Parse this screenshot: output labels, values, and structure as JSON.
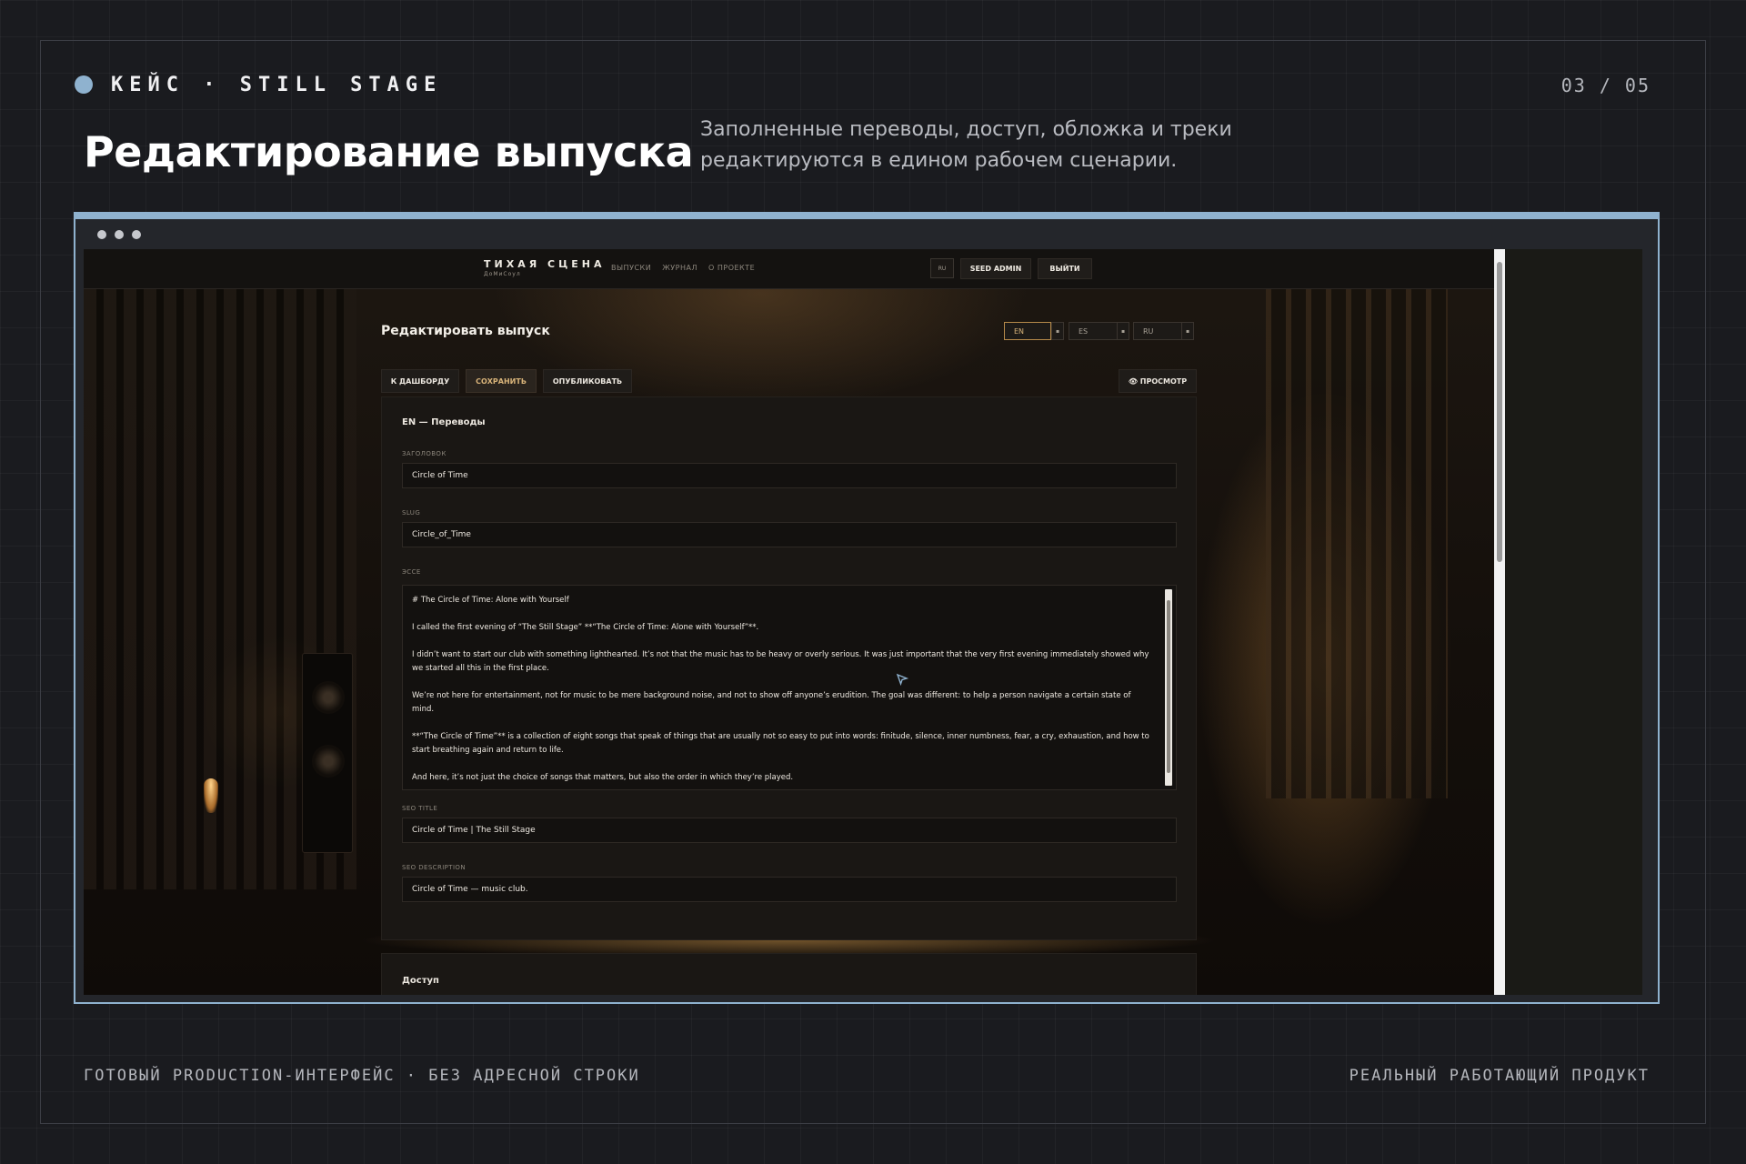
{
  "slide": {
    "kicker": "КЕЙС · STILL STAGE",
    "pager": "03 / 05",
    "title": "Редактирование выпуска",
    "subtitle": "Заполненные переводы, доступ, обложка и треки редактируются в едином рабочем сценарии.",
    "footer_left": "ГОТОВЫЙ PRODUCTION-ИНТЕРФЕЙС · БЕЗ АДРЕСНОЙ СТРОКИ",
    "footer_right": "РЕАЛЬНЫЙ РАБОТАЮЩИЙ ПРОДУКТ",
    "accent": "#8fb2cf"
  },
  "app": {
    "brand": {
      "name": "ТИХАЯ СЦЕНА",
      "sub": "ДоМиСоул"
    },
    "nav": [
      "ВЫПУСКИ",
      "ЖУРНАЛ",
      "О ПРОЕКТЕ"
    ],
    "lang_badge": "RU",
    "user_button": "SEED ADMIN",
    "logout_button": "ВЫЙТИ",
    "heading": "Редактировать выпуск",
    "languages": [
      "EN",
      "ES",
      "RU"
    ],
    "active_language": "EN",
    "actions": {
      "back": "К ДАШБОРДУ",
      "save": "СОХРАНИТЬ",
      "publish": "ОПУБЛИКОВАТЬ",
      "preview": "👁 ПРОСМОТР"
    },
    "translations": {
      "title": "EN — Переводы",
      "fields": {
        "title_label": "ЗАГОЛОВОК",
        "title_value": "Circle of Time",
        "slug_label": "SLUG",
        "slug_value": "Circle_of_Time",
        "essay_label": "ЭССЕ",
        "essay_paragraphs": [
          "# The Circle of Time: Alone with Yourself",
          "I called the first evening of “The Still Stage” **“The Circle of Time: Alone with Yourself”**.",
          "I didn’t want to start our club with something lighthearted. It’s not that the music has to be heavy or overly serious. It was just important that the very first evening immediately showed why we started all this in the first place.",
          "We’re not here for entertainment, not for music to be mere background noise, and not to show off anyone’s erudition. The goal was different: to help a person navigate a certain state of mind.",
          "**“The Circle of Time”** is a collection of eight songs that speak of things that are usually not so easy to put into words: finitude, silence, inner numbness, fear, a cry, exhaustion, and how to start breathing again and return to life.",
          "And here, it’s not just the choice of songs that matters, but also the order in which they’re played."
        ],
        "seo_title_label": "SEO TITLE",
        "seo_title_value": "Circle of Time | The Still Stage",
        "seo_desc_label": "SEO DESCRIPTION",
        "seo_desc_value": "Circle of Time — music club."
      }
    },
    "access_title": "Доступ"
  }
}
